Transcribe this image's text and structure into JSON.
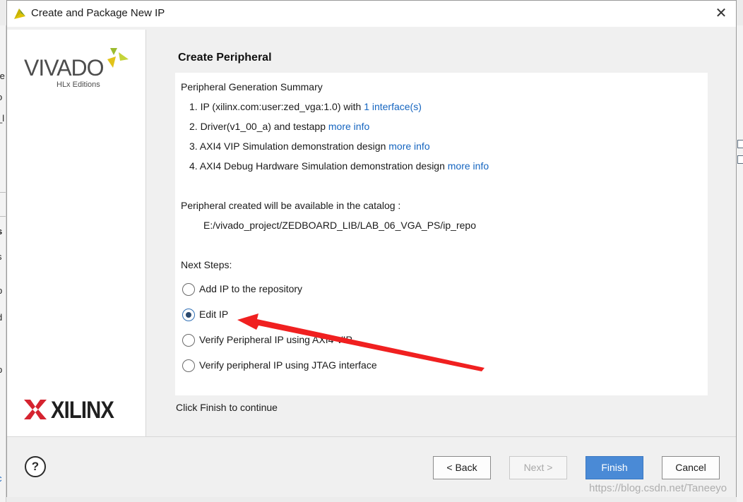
{
  "window": {
    "title": "Create and Package New IP",
    "close_icon": "close-icon"
  },
  "branding": {
    "vivado": "VIVADO",
    "vivado_sub": "HLx Editions",
    "xilinx": "XILINX"
  },
  "page": {
    "title": "Create Peripheral",
    "summary_heading": "Peripheral Generation Summary",
    "items": [
      {
        "text": "1. IP (xilinx.com:user:zed_vga:1.0) with ",
        "link": "1 interface(s)"
      },
      {
        "text": "2. Driver(v1_00_a) and testapp ",
        "link": "more info"
      },
      {
        "text": "3. AXI4 VIP Simulation demonstration design ",
        "link": "more info"
      },
      {
        "text": "4. AXI4 Debug Hardware Simulation demonstration design ",
        "link": "more info"
      }
    ],
    "catalog_text": "Peripheral created will be available in the catalog :",
    "catalog_path": "E:/vivado_project/ZEDBOARD_LIB/LAB_06_VGA_PS/ip_repo",
    "next_steps_label": "Next Steps:",
    "next_steps": [
      {
        "label": "Add IP to the repository",
        "checked": false
      },
      {
        "label": "Edit IP",
        "checked": true
      },
      {
        "label": "Verify Peripheral IP using AXI4 VIP",
        "checked": false
      },
      {
        "label": "Verify peripheral IP using JTAG interface",
        "checked": false
      }
    ],
    "footer_hint": "Click Finish to continue"
  },
  "buttons": {
    "help": "?",
    "back": "< Back",
    "next": "Next >",
    "finish": "Finish",
    "cancel": "Cancel"
  },
  "background_window": {
    "fragments": [
      "te",
      "o",
      "_l",
      "s",
      "s",
      "p",
      "d",
      "p",
      "c"
    ]
  },
  "annotation": {
    "color": "#f02020"
  },
  "watermark": "https://blog.csdn.net/Taneeyo"
}
